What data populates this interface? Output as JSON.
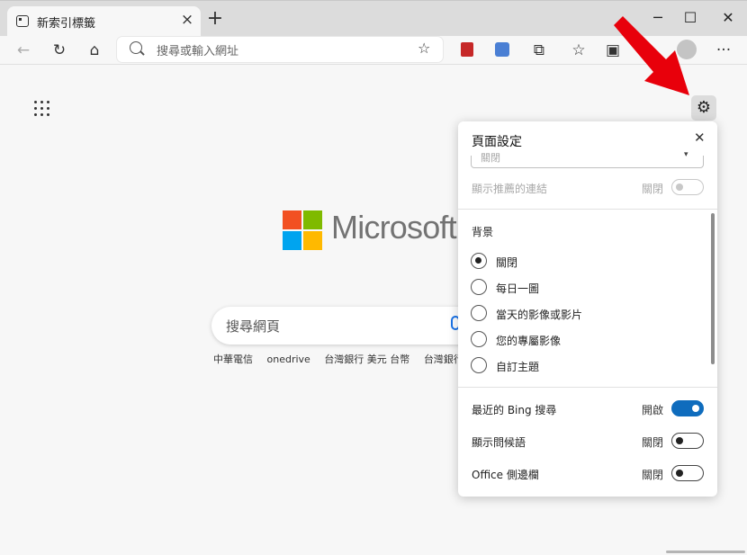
{
  "browser": {
    "tab_title": "新索引標籤",
    "tab_close": "×",
    "new_tab": "+",
    "window_controls": {
      "minimize": "─",
      "maximize": "☐",
      "close": "✕"
    }
  },
  "toolbar": {
    "back": "←",
    "refresh": "↻",
    "home": "⌂",
    "address_placeholder": "搜尋或輸入網址",
    "favorite_add": "☆",
    "extensions": "⧉",
    "favorites": "☆",
    "collections": "▣",
    "more": "···"
  },
  "page": {
    "brand_word": "Microsoft",
    "search_placeholder": "搜尋網頁",
    "quick_links": [
      "中華電信",
      "onedrive",
      "台灣銀行 美元 台幣",
      "台灣銀行美元"
    ],
    "settings_icon": "⚙"
  },
  "settings_panel": {
    "title": "頁面設定",
    "close": "✕",
    "select_value": "關閉",
    "select_caret": "▾",
    "show_links": {
      "label": "顯示推薦的連結",
      "state": "關閉",
      "on": false
    },
    "background_section": "背景",
    "background_options": [
      {
        "label": "關閉",
        "checked": true
      },
      {
        "label": "每日一圖",
        "checked": false
      },
      {
        "label": "當天的影像或影片",
        "checked": false
      },
      {
        "label": "您的專屬影像",
        "checked": false
      },
      {
        "label": "自訂主題",
        "checked": false
      }
    ],
    "toggles": [
      {
        "label": "最近的 Bing 搜尋",
        "state": "開啟",
        "on": true
      },
      {
        "label": "顯示問候語",
        "state": "關閉",
        "on": false
      },
      {
        "label": "Office 側邊欄",
        "state": "關閉",
        "on": false
      }
    ]
  },
  "colors": {
    "accent": "#0f6cbd",
    "arrow": "#e8000b",
    "ms_red": "#f25022",
    "ms_green": "#7fba00",
    "ms_blue": "#00a4ef",
    "ms_yellow": "#ffb900"
  }
}
